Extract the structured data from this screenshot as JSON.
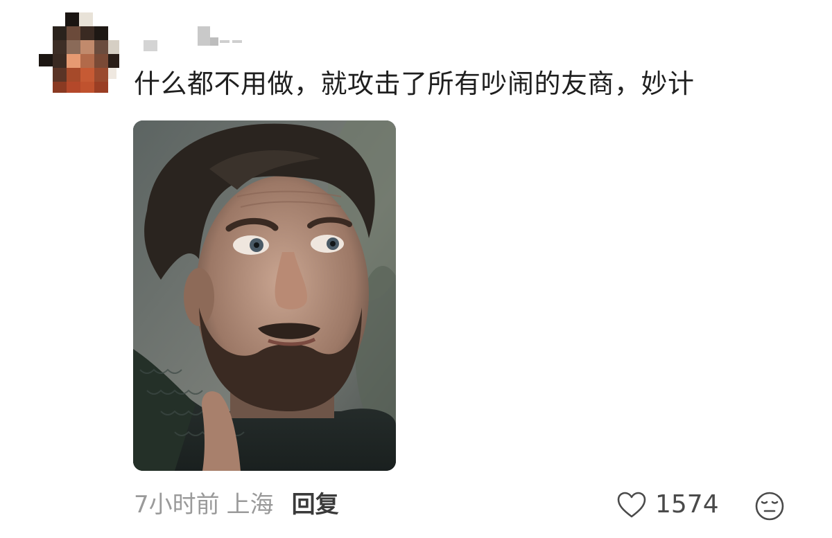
{
  "comment": {
    "username": "",
    "text": "什么都不用做，就攻击了所有吵闹的友商，妙计",
    "time": "7小时前",
    "location": "上海",
    "reply_label": "回复",
    "like_count": "1574"
  },
  "icons": {
    "like": "heart-outline-icon",
    "emoji": "emoji-expressionless-icon"
  },
  "colors": {
    "text_primary": "#1f1f1f",
    "text_secondary": "#9a9a9a",
    "reply": "#3a3a3a"
  }
}
